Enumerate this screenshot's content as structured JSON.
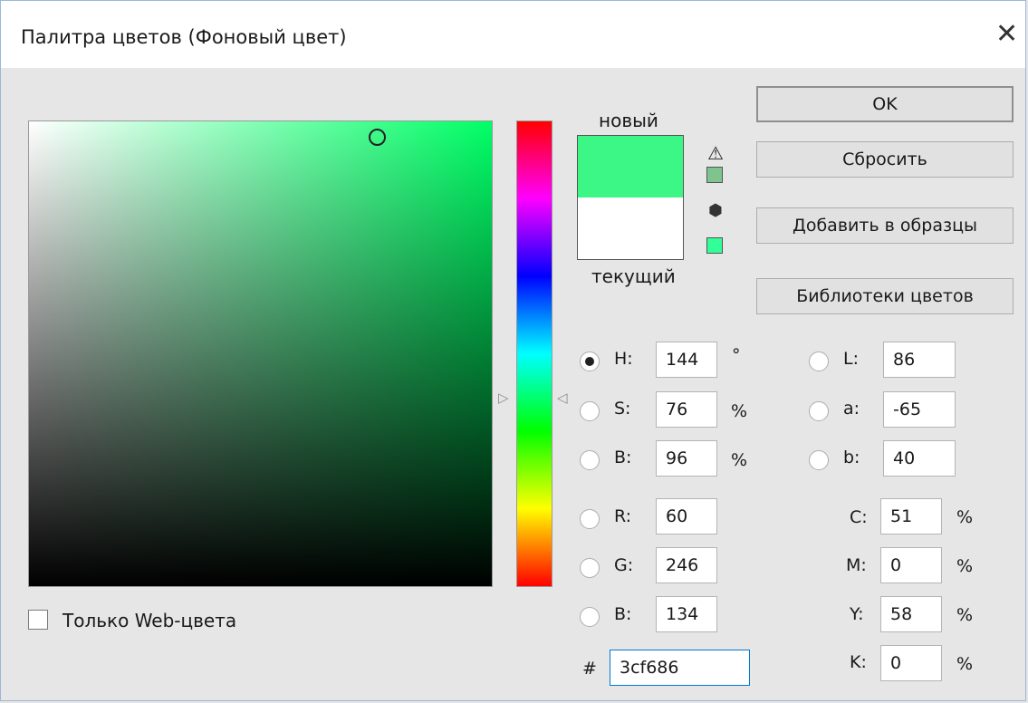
{
  "window": {
    "title": "Палитра цветов (Фоновый цвет)",
    "close": "✕"
  },
  "swatch": {
    "new_label": "новый",
    "current_label": "текущий",
    "new_color": "#3cf686",
    "current_color": "#ffffff",
    "gamut_warning_color": "#7fc48e",
    "web_safe_color": "#33ff99",
    "warning_icon": "⚠",
    "cube_icon": "⬢"
  },
  "buttons": {
    "ok": "OK",
    "reset": "Сбросить",
    "add_to_swatches": "Добавить в образцы",
    "color_libraries": "Библиотеки цветов"
  },
  "hsb": {
    "h": {
      "label": "H:",
      "value": "144",
      "unit": "°",
      "selected": true
    },
    "s": {
      "label": "S:",
      "value": "76",
      "unit": "%"
    },
    "b": {
      "label": "B:",
      "value": "96",
      "unit": "%"
    }
  },
  "rgb": {
    "r": {
      "label": "R:",
      "value": "60"
    },
    "g": {
      "label": "G:",
      "value": "246"
    },
    "b": {
      "label": "B:",
      "value": "134"
    }
  },
  "lab": {
    "l": {
      "label": "L:",
      "value": "86"
    },
    "a": {
      "label": "a:",
      "value": "-65"
    },
    "b": {
      "label": "b:",
      "value": "40"
    }
  },
  "cmyk": {
    "c": {
      "label": "C:",
      "value": "51",
      "unit": "%"
    },
    "m": {
      "label": "M:",
      "value": "0",
      "unit": "%"
    },
    "y": {
      "label": "Y:",
      "value": "58",
      "unit": "%"
    },
    "k": {
      "label": "K:",
      "value": "0",
      "unit": "%"
    }
  },
  "hex": {
    "label": "#",
    "value": "3cf686"
  },
  "web_only": {
    "label": "Только Web-цвета",
    "checked": false
  },
  "hue_slider": {
    "hue_degrees": 144,
    "arrow_left": "▷",
    "arrow_right": "◁"
  }
}
